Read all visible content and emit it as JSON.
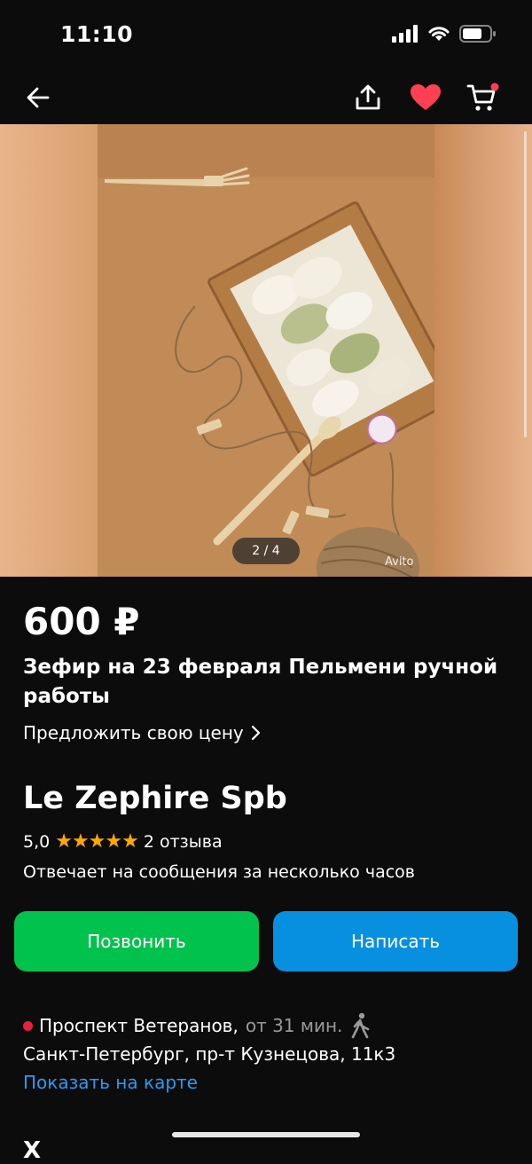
{
  "status_bar": {
    "time": "11:10"
  },
  "nav": {
    "back_icon": "arrow-left-icon",
    "share_icon": "share-icon",
    "favorite_icon": "heart-icon",
    "cart_icon": "cart-icon"
  },
  "gallery": {
    "counter": "2 / 4",
    "watermark": "Avito"
  },
  "listing": {
    "price": "600 ₽",
    "title": "Зефир на 23 февраля Пельмени ручной работы",
    "offer_price": "Предложить свою цену"
  },
  "seller": {
    "name": "Le Zephire Spb",
    "rating": "5,0",
    "stars": "★★★★★",
    "stars_value": 5,
    "reviews": "2 отзыва",
    "response_time": "Отвечает на сообщения за несколько часов"
  },
  "actions": {
    "call": "Позвонить",
    "message": "Написать"
  },
  "location": {
    "metro": "Проспект Ветеранов,",
    "walk_time": "от 31 мин.",
    "address": "Санкт-Петербург, пр-т Кузнецова, 11к3",
    "map_link": "Показать на карте"
  },
  "next_section": "Х",
  "colors": {
    "background": "#0c0c0c",
    "call": "#02c24e",
    "message": "#0890e0",
    "link": "#2b9af3",
    "star": "#ffa900",
    "favorite": "#ff4053",
    "metro": "#e8203c"
  }
}
